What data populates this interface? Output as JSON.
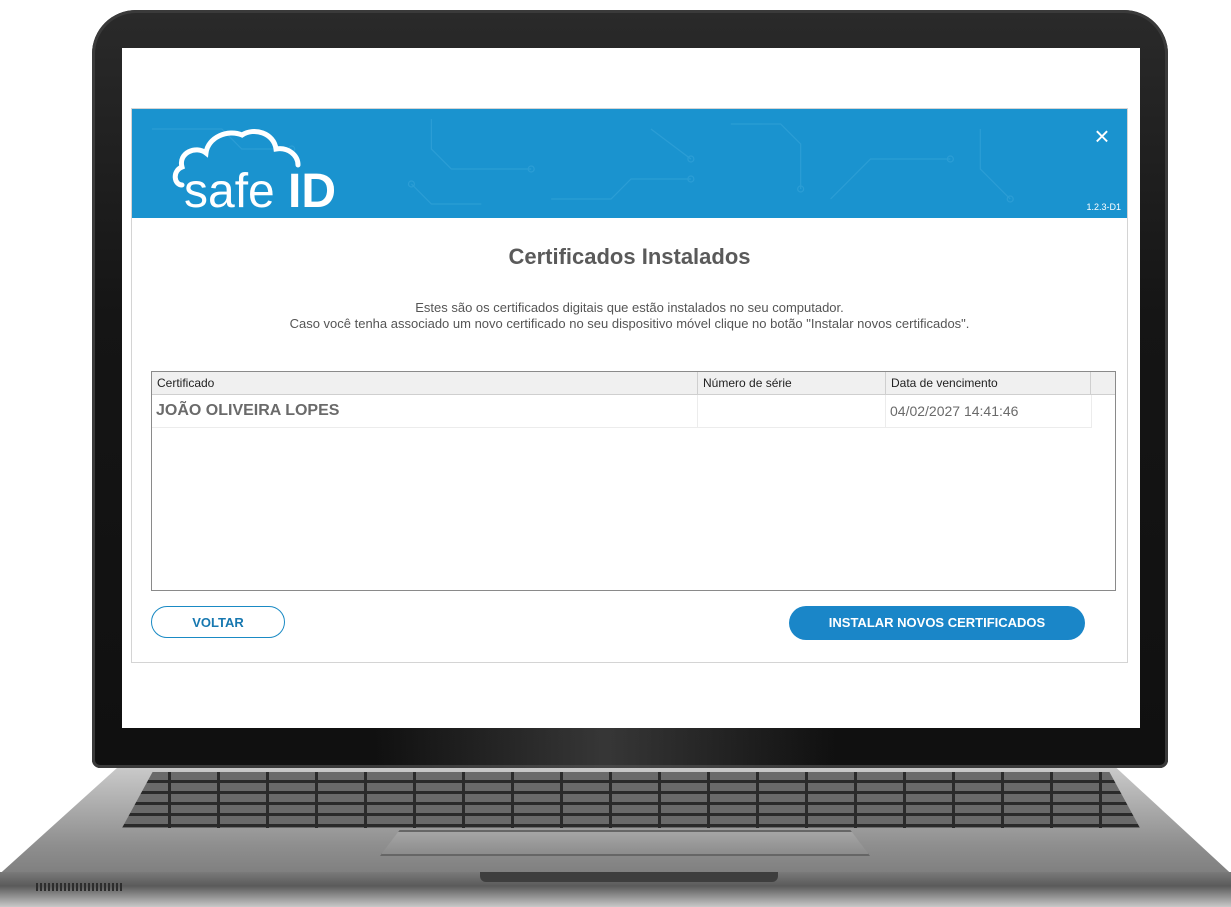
{
  "brand": {
    "logo_text_left": "safe",
    "logo_text_right": "ID",
    "version": "1.2.3-D1"
  },
  "window": {
    "close_symbol": "×"
  },
  "page": {
    "title": "Certificados Instalados",
    "description_line1": "Estes são os certificados digitais que estão instalados no seu computador.",
    "description_line2": "Caso você tenha associado um novo certificado no seu dispositivo móvel clique no botão \"Instalar novos certificados\"."
  },
  "table": {
    "columns": [
      "Certificado",
      "Número de série",
      "Data de vencimento"
    ],
    "rows": [
      {
        "certificado": "JOÃO OLIVEIRA LOPES",
        "numero_serie": "",
        "data_vencimento": "04/02/2027 14:41:46"
      }
    ]
  },
  "buttons": {
    "back": "VOLTAR",
    "install": "INSTALAR NOVOS CERTIFICADOS"
  },
  "colors": {
    "accent": "#1a93cf",
    "title": "#5a5a5a",
    "button": "#1a86c8"
  },
  "icons": {
    "close": "close-icon",
    "logo": "cloud-logo-icon"
  }
}
